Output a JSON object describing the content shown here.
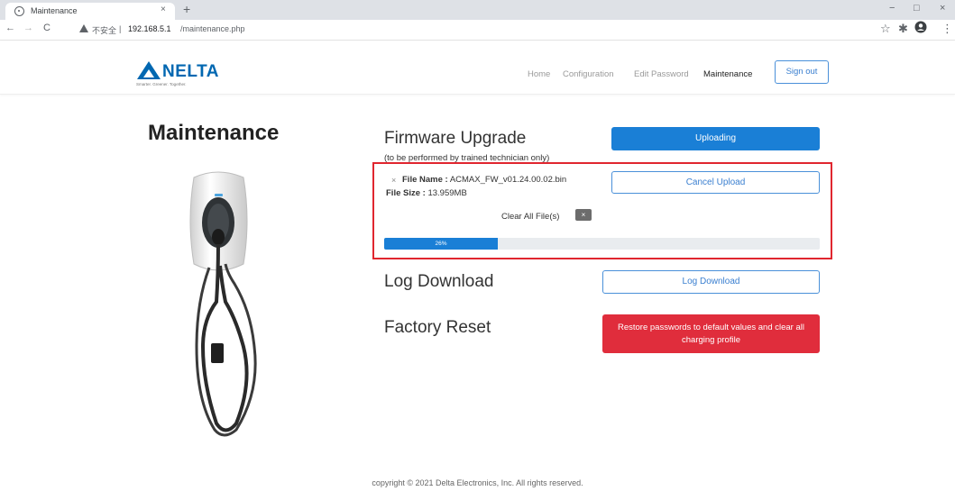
{
  "browser": {
    "tab_title": "Maintenance",
    "tab_close": "×",
    "new_tab": "+",
    "win_minimize": "−",
    "win_maximize": "□",
    "win_close": "×",
    "nav_back": "←",
    "nav_forward": "→",
    "nav_reload": "C",
    "not_secure": "不安全",
    "url_host": "192.168.5.1",
    "url_path": "/maintenance.php",
    "star": "☆",
    "extensions": "✱",
    "menu": "⋮"
  },
  "header": {
    "logo_text": "NELTA",
    "logo_tagline": "Smarter. Greener. Together.",
    "brand_color": "#0067b1",
    "nav": {
      "home": "Home",
      "configuration": "Configuration",
      "edit_password": "Edit Password",
      "maintenance": "Maintenance"
    },
    "sign_out": "Sign out"
  },
  "main": {
    "page_title": "Maintenance",
    "firmware": {
      "title": "Firmware Upgrade",
      "note": "(to be performed by trained technician only)",
      "upload_button": "Uploading",
      "file_remove": "×",
      "file_name_label": "File Name :",
      "file_name": "ACMAX_FW_v01.24.00.02.bin",
      "file_size_label": "File Size :",
      "file_size": "13.959MB",
      "cancel_button": "Cancel Upload",
      "clear_all": "Clear All File(s)",
      "clear_icon": "×",
      "progress_percent": 26,
      "progress_label": "26%"
    },
    "log": {
      "title": "Log Download",
      "button": "Log Download"
    },
    "factory": {
      "title": "Factory Reset",
      "button": "Restore passwords to default values and clear all charging profile"
    }
  },
  "colors": {
    "primary": "#1a7fd6",
    "danger": "#e02d3c",
    "highlight_border": "#e0262f"
  },
  "footer": {
    "copyright": "copyright © 2021 Delta Electronics, Inc.    All rights reserved."
  }
}
